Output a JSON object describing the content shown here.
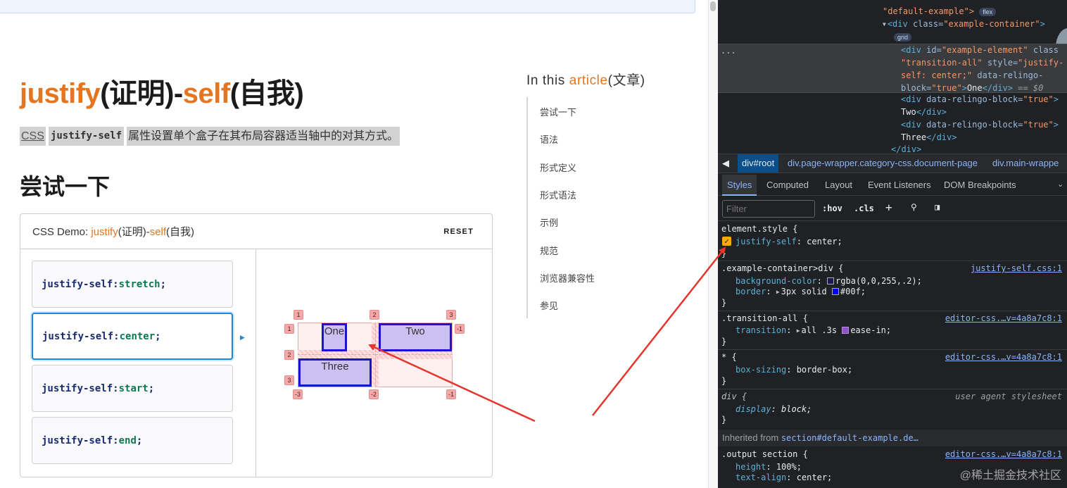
{
  "page": {
    "title_part1": "justify",
    "title_part2": "(证明)-",
    "title_part3": "self",
    "title_part4": "(自我)",
    "desc_css": "CSS",
    "desc_code": "justify-self",
    "desc_text": "属性设置单个盒子在其布局容器适当轴中的对其方式。",
    "try_heading": "尝试一下"
  },
  "demo": {
    "title_prefix": "CSS Demo: ",
    "title_part1": "justify",
    "title_part2": "(证明)-",
    "title_part3": "self",
    "title_part4": "(自我)",
    "reset_label": "RESET",
    "choices": [
      {
        "prop": "justify-self",
        "sep": ": ",
        "value": "stretch",
        "end": ";"
      },
      {
        "prop": "justify-self",
        "sep": ": ",
        "value": "center",
        "end": ";"
      },
      {
        "prop": "justify-self",
        "sep": ": ",
        "value": "start",
        "end": ";"
      },
      {
        "prop": "justify-self",
        "sep": ": ",
        "value": "end",
        "end": ";"
      }
    ],
    "selected_index": 1,
    "grid_items": [
      "One",
      "Two",
      "Three"
    ],
    "col_badges_top": [
      "1",
      "2",
      "3"
    ],
    "col_badges_bottom": [
      "-3",
      "-2",
      "-1"
    ],
    "row_badges": [
      "1",
      "2",
      "3"
    ],
    "row_badge_right": "-1"
  },
  "toc": {
    "heading_part1": "In this ",
    "heading_part2": "article",
    "heading_part3": "(文章)",
    "items": [
      "尝试一下",
      "语法",
      "形式定义",
      "形式语法",
      "示例",
      "规范",
      "浏览器兼容性",
      "参见"
    ]
  },
  "devtools": {
    "dom": {
      "l1_tag_open": "\"default-example\">",
      "l1_pill": "flex",
      "l2_tag": "<div",
      "l2_attr": " class=",
      "l2_val": "\"example-container\"",
      "l2_end": ">",
      "l2_pill": "grid",
      "sel_1a": "<div",
      "sel_1b": " id=",
      "sel_1c": "\"example-element\"",
      "sel_1d": " class",
      "sel_2": "\"transition-all\"",
      "sel_2b": " style=",
      "sel_2c": "\"justify-",
      "sel_3": "self: center;\"",
      "sel_3b": " data-relingo-",
      "sel_4a": "block=",
      "sel_4b": "\"true\"",
      "sel_4c": ">",
      "sel_4d": "One",
      "sel_4e": "</div>",
      "sel_4f": " == $0",
      "two_a": "<div",
      "two_b": " data-relingo-block=",
      "two_c": "\"true\"",
      "two_d": ">",
      "two_text": "Two",
      "two_end": "</div>",
      "three_a": "<div",
      "three_b": " data-relingo-block=",
      "three_c": "\"true\"",
      "three_d": ">",
      "three_text": "Three",
      "three_end": "</div>",
      "close": "</div>",
      "dots": "..."
    },
    "breadcrumbs": [
      "div#root",
      "div.page-wrapper.category-css.document-page",
      "div.main-wrappe"
    ],
    "tabs": [
      "Styles",
      "Computed",
      "Layout",
      "Event Listeners",
      "DOM Breakpoints"
    ],
    "filter_placeholder": "Filter",
    "tools": [
      ":hov",
      ".cls",
      "+"
    ],
    "rules": {
      "element_style_sel": "element.style {",
      "element_style_prop": "justify-self",
      "element_style_val": "center;",
      "close": "}",
      "r1_sel": ".example-container>div {",
      "r1_src": "justify-self.css:1",
      "r1_p1": "background-color",
      "r1_v1": "rgba(0,0,255,.2);",
      "r1_p2": "border",
      "r1_v2a": "3px solid ",
      "r1_v2b": "#00f;",
      "r2_sel": ".transition-all {",
      "r2_src": "editor-css.…v=4a8a7c8:1",
      "r2_p1": "transition",
      "r2_v1a": "all .3s ",
      "r2_v1b": "ease-in;",
      "r3_sel": "* {",
      "r3_src": "editor-css.…v=4a8a7c8:1",
      "r3_p1": "box-sizing",
      "r3_v1": "border-box;",
      "r4_sel": "div {",
      "r4_src": "user agent stylesheet",
      "r4_p1": "display",
      "r4_v1": "block;",
      "inherited_label": "Inherited from ",
      "inherited_link": "section#default-example.de…",
      "r5_sel": ".output section {",
      "r5_src": "editor-css.…v=4a8a7c8:1",
      "r5_p1": "height",
      "r5_v1": "100%;",
      "r5_p2": "text-align",
      "r5_v2": "center;"
    },
    "watermark": "@稀土掘金技术社区"
  },
  "colors": {
    "accent_orange": "#e5761f",
    "selection_blue": "#1e8ad6",
    "annotation_red": "#e5352c"
  }
}
